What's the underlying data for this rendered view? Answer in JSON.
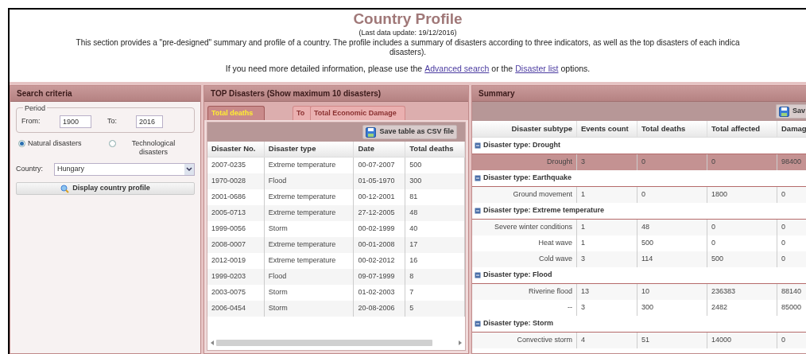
{
  "header": {
    "title": "Country Profile",
    "last_update": "(Last data update: 19/12/2016)",
    "description_lines": [
      "This section provides a \"pre-designed\" summary and profile of a country. The profile includes a summary of disasters according to three indicators, as well as the top disasters of each indica",
      "disasters)."
    ],
    "info_before": "If you need more detailed information, please use the",
    "link_1": "Advanced search",
    "info_middle": "or the",
    "link_2": "Disaster list",
    "info_after": "options."
  },
  "search": {
    "title": "Search criteria",
    "period_legend": "Period",
    "from_label": "From:",
    "from_value": "1900",
    "to_label": "To:",
    "to_value": "2016",
    "radios": [
      {
        "label": "Natural disasters",
        "selected": true
      },
      {
        "label": "Technological disasters",
        "selected": false
      }
    ],
    "country_label": "Country:",
    "country_value": "Hungary",
    "button": "Display country profile"
  },
  "top": {
    "title": "TOP Disasters (Show maximum 10 disasters)",
    "tabs": [
      {
        "label": "Total deaths",
        "selected": true
      },
      {
        "label": "To",
        "selected": false
      },
      {
        "label": "Total Economic Damage",
        "selected": false
      }
    ],
    "save_button": "Save table as CSV file",
    "columns": [
      "Disaster No.",
      "Disaster type",
      "Date",
      "Total deaths"
    ],
    "rows": [
      [
        "2007-0235",
        "Extreme temperature",
        "00-07-2007",
        "500"
      ],
      [
        "1970-0028",
        "Flood",
        "01-05-1970",
        "300"
      ],
      [
        "2001-0686",
        "Extreme temperature",
        "00-12-2001",
        "81"
      ],
      [
        "2005-0713",
        "Extreme temperature",
        "27-12-2005",
        "48"
      ],
      [
        "1999-0056",
        "Storm",
        "00-02-1999",
        "40"
      ],
      [
        "2008-0007",
        "Extreme temperature",
        "00-01-2008",
        "17"
      ],
      [
        "2012-0019",
        "Extreme temperature",
        "00-02-2012",
        "16"
      ],
      [
        "1999-0203",
        "Flood",
        "09-07-1999",
        "8"
      ],
      [
        "2003-0075",
        "Storm",
        "01-02-2003",
        "7"
      ],
      [
        "2006-0454",
        "Storm",
        "20-08-2006",
        "5"
      ]
    ]
  },
  "summary": {
    "title": "Summary",
    "save_button": "Sav",
    "columns": [
      "Disaster subtype",
      "Events count",
      "Total deaths",
      "Total affected",
      "Damag"
    ],
    "groups": [
      {
        "label": "Disaster type: Drought",
        "expanded": true,
        "rows": [
          {
            "cells": [
              "Drought",
              "3",
              "0",
              "0",
              "98400"
            ],
            "selected": true
          }
        ]
      },
      {
        "label": "Disaster type: Earthquake",
        "expanded": true,
        "rows": [
          {
            "cells": [
              "Ground movement",
              "1",
              "0",
              "1800",
              "0"
            ],
            "selected": false
          }
        ]
      },
      {
        "label": "Disaster type: Extreme temperature",
        "expanded": true,
        "rows": [
          {
            "cells": [
              "Severe winter conditions",
              "1",
              "48",
              "0",
              "0"
            ],
            "selected": false
          },
          {
            "cells": [
              "Heat wave",
              "1",
              "500",
              "0",
              "0"
            ],
            "selected": false
          },
          {
            "cells": [
              "Cold wave",
              "3",
              "114",
              "500",
              "0"
            ],
            "selected": false
          }
        ]
      },
      {
        "label": "Disaster type: Flood",
        "expanded": true,
        "rows": [
          {
            "cells": [
              "Riverine flood",
              "13",
              "10",
              "236383",
              "88140"
            ],
            "selected": false
          },
          {
            "cells": [
              "--",
              "3",
              "300",
              "2482",
              "85000"
            ],
            "selected": false
          }
        ]
      },
      {
        "label": "Disaster type: Storm",
        "expanded": true,
        "rows": [
          {
            "cells": [
              "Convective storm",
              "4",
              "51",
              "14000",
              "0"
            ],
            "selected": false
          }
        ]
      }
    ]
  }
}
